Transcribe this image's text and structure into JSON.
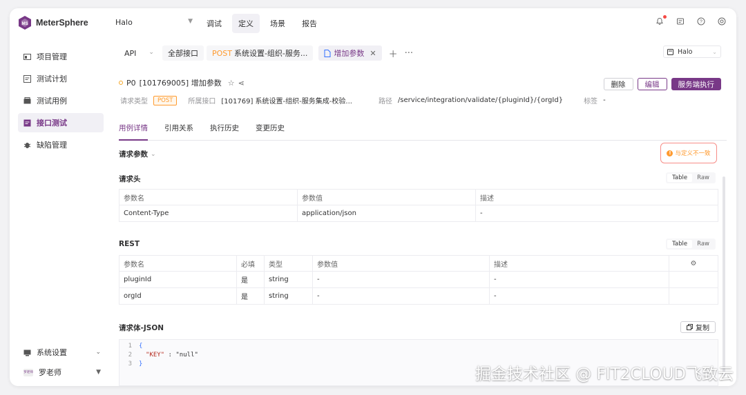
{
  "app": {
    "name": "MeterSphere"
  },
  "header": {
    "project": "Halo",
    "nav": [
      "调试",
      "定义",
      "场景",
      "报告"
    ],
    "active_nav": "定义",
    "icons": [
      "bell-icon",
      "task-icon",
      "help-icon",
      "settings-icon"
    ]
  },
  "sidebar": {
    "items": [
      {
        "label": "项目管理",
        "icon": "project-icon"
      },
      {
        "label": "测试计划",
        "icon": "plan-icon"
      },
      {
        "label": "测试用例",
        "icon": "case-icon"
      },
      {
        "label": "接口测试",
        "icon": "api-icon",
        "active": true
      },
      {
        "label": "缺陷管理",
        "icon": "bug-icon"
      }
    ],
    "system": "系统设置",
    "user_avatar": "罗老师",
    "user": "罗老师"
  },
  "tabs": {
    "module": "API",
    "all": "全部接口",
    "tab1_method": "POST",
    "tab1_name": "系统设置-组织-服务...",
    "tab2_name": "增加参数"
  },
  "env": {
    "value": "Halo"
  },
  "case": {
    "priority": "P0",
    "title": "[101769005] 增加参数",
    "buttons": {
      "delete": "删除",
      "edit": "编辑",
      "run": "服务端执行"
    }
  },
  "meta": {
    "method_label": "请求类型",
    "method": "POST",
    "api_label": "所属接口",
    "api": "[101769] 系统设置-组织-服务集成-校验...",
    "path_label": "路径",
    "path": "/service/integration/validate/{pluginId}/{orgId}",
    "tag_label": "标签",
    "tag": "-"
  },
  "subtabs": [
    "用例详情",
    "引用关系",
    "执行历史",
    "变更历史"
  ],
  "request": {
    "title": "请求参数",
    "mismatch": "与定义不一致",
    "headers_title": "请求头",
    "seg": [
      "Table",
      "Raw"
    ],
    "headers_cols": [
      "参数名",
      "参数值",
      "描述"
    ],
    "headers_rows": [
      [
        "Content-Type",
        "application/json",
        "-"
      ]
    ],
    "rest_title": "REST",
    "rest_cols": [
      "参数名",
      "必填",
      "类型",
      "参数值",
      "描述"
    ],
    "rest_rows": [
      [
        "pluginId",
        "是",
        "string",
        "-",
        "-"
      ],
      [
        "orgId",
        "是",
        "string",
        "-",
        "-"
      ]
    ],
    "body_title": "请求体-JSON",
    "copy": "复制",
    "code": [
      {
        "ln": "1",
        "text": "{"
      },
      {
        "ln": "2",
        "key": "\"KEY\"",
        "sep": " : ",
        "val": "\"null\""
      },
      {
        "ln": "3",
        "text": "}"
      }
    ]
  },
  "watermark": "掘金技术社区 @ FIT2CLOUD飞致云",
  "colors": {
    "brand": "#783887",
    "post": "#ff9a2e",
    "warn_border": "#f78d87"
  }
}
